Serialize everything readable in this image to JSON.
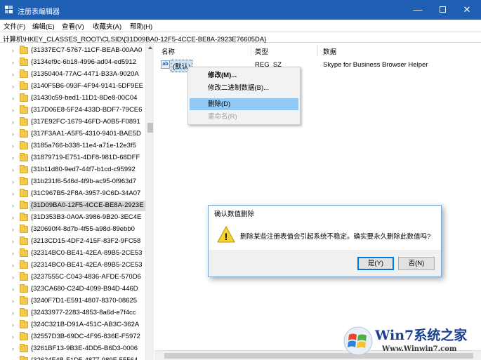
{
  "window": {
    "title": "注册表编辑器",
    "min_glyph": "—",
    "close_glyph": "✕"
  },
  "menu": [
    "文件(F)",
    "编辑(E)",
    "查看(V)",
    "收藏夹(A)",
    "帮助(H)"
  ],
  "address": "计算机\\HKEY_CLASSES_ROOT\\CLSID\\{31D09BA0-12F5-4CCE-BE8A-2923E76605DA}",
  "tree": {
    "items": [
      "{31337EC7-5767-11CF-BEAB-00AA0",
      "{3134ef9c-6b18-4996-ad04-ed5912",
      "{31350404-77AC-4471-B33A-9020A",
      "{3140F5B6-093F-4F94-9141-5DF9EE",
      "{31430c59-bed1-11D1-8De8-00C04",
      "{317D06E8-5F24-433D-BDF7-79CE6",
      "{317E92FC-1679-46FD-A0B5-F0891",
      "{317F3AA1-A5F5-4310-9401-BAE5D",
      "{3185a766-b338-11e4-a71e-12e3f5",
      "{31879719-E751-4DF8-981D-68DFF",
      "{31b11d80-9ed7-44f7-b1cd-c95992",
      "{31b231f6-546d-4f9b-ac95-0f963d7",
      "{31C967B5-2F8A-3957-9C6D-34A07",
      "{31D09BA0-12F5-4CCE-BE8A-2923E",
      "{31D353B3-0A0A-3986-9B20-3EC4E",
      "{320690f4-8d7b-4f55-a98d-89ebb0",
      "{3213CD15-4DF2-415F-83F2-9FC58",
      "{32314BC0-BE41-42EA-89B5-2CE53",
      "{32314BC0-BE41-42EA-89B5-2CE53",
      "{3237555C-C043-4836-AFDE-570D6",
      "{323CA680-C24D-4099-B94D-446D",
      "{3240F7D1-E591-4807-8370-08625",
      "{32433977-2283-4853-8a6d-e7f4cc",
      "{324C321B-D91A-451C-AB3C-362A",
      "{32557D3B-69DC-4F95-836E-F5972",
      "{3261BF13-9B3E-4DD5-B6D3-0006",
      "{32624F4B-F1D5-4877-989F-55564"
    ],
    "selected_index": 13,
    "chevron": "›"
  },
  "columns": {
    "name": "名称",
    "type": "类型",
    "data": "数据"
  },
  "value_row": {
    "icon_text": "ab",
    "name": "(默认)",
    "type": "REG_SZ",
    "data": "Skype for Business Browser Helper"
  },
  "context_menu": {
    "modify": "修改(M)...",
    "modify_binary": "修改二进制数据(B)...",
    "delete": "删除(D)",
    "rename": "重命名(R)"
  },
  "dialog": {
    "title": "确认数值删除",
    "message": "删除某些注册表值会引起系统不稳定。确实要永久删除此数值吗?",
    "yes": "是(Y)",
    "no": "否(N)",
    "warn_glyph": "!"
  },
  "watermark": {
    "text": "Win7系统之家",
    "url": "Www.Winwin7.com"
  },
  "colors": {
    "titlebar": "#1e5fb4",
    "menu_highlight": "#91c9f7",
    "selection": "#cce4f7"
  }
}
